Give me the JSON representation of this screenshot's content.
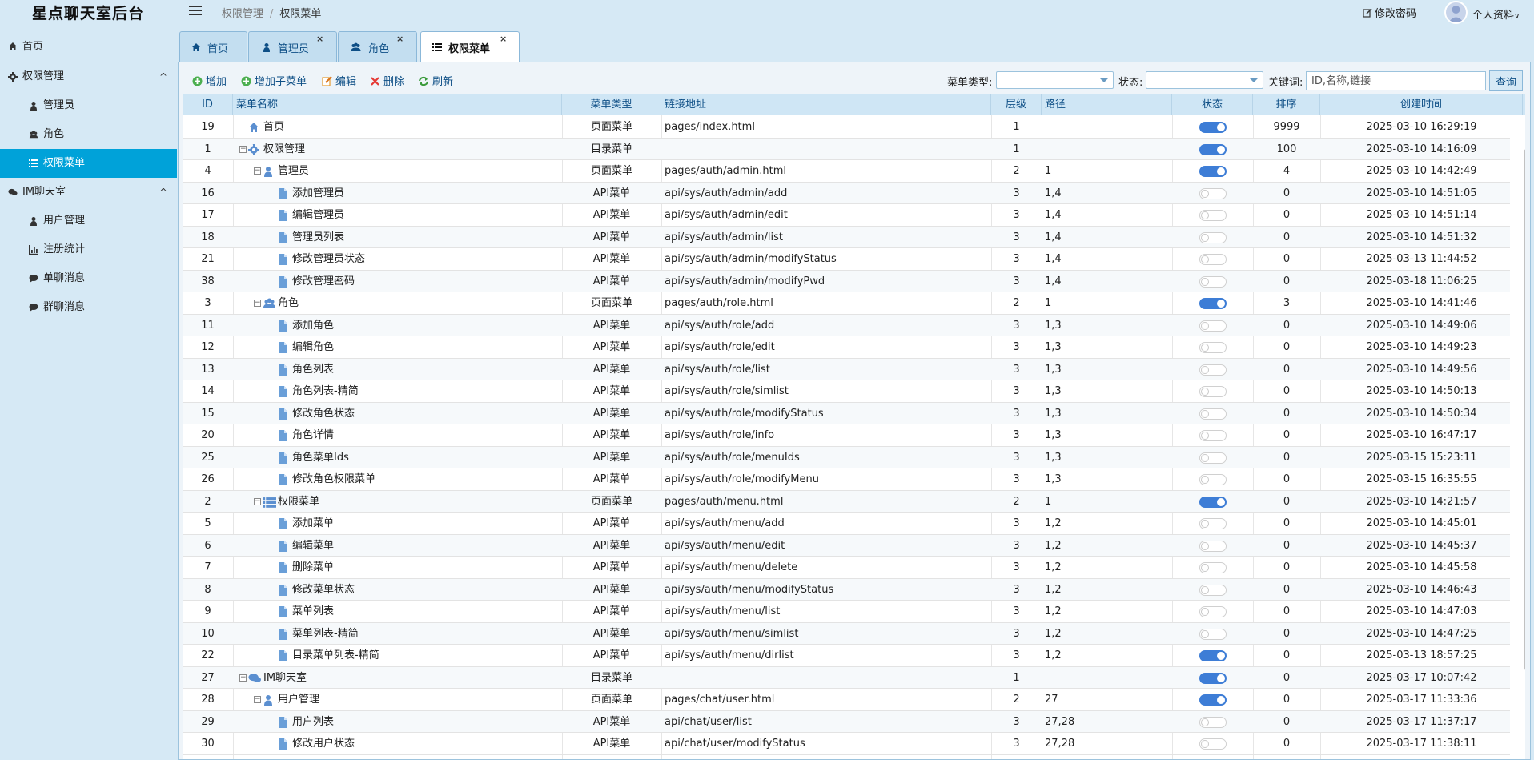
{
  "app": {
    "title": "星点聊天室后台"
  },
  "breadcrumb": {
    "parent": "权限管理",
    "sep": "/",
    "current": "权限菜单"
  },
  "header": {
    "change_pwd": "修改密码",
    "profile": "个人资料"
  },
  "sidebar": {
    "items": [
      {
        "label": "首页",
        "icon": "home-icon"
      },
      {
        "label": "权限管理",
        "icon": "gear-icon"
      },
      {
        "label": "管理员",
        "icon": "user-icon"
      },
      {
        "label": "角色",
        "icon": "users-icon"
      },
      {
        "label": "权限菜单",
        "icon": "list-icon"
      },
      {
        "label": "IM聊天室",
        "icon": "chat-icon"
      },
      {
        "label": "用户管理",
        "icon": "user-icon"
      },
      {
        "label": "注册统计",
        "icon": "bar-chart-icon"
      },
      {
        "label": "单聊消息",
        "icon": "comment-icon"
      },
      {
        "label": "群聊消息",
        "icon": "comment-icon"
      }
    ]
  },
  "tabs": [
    {
      "label": "首页",
      "icon": "home-icon"
    },
    {
      "label": "管理员",
      "icon": "user-icon",
      "close": "×"
    },
    {
      "label": "角色",
      "icon": "users-icon",
      "close": "×"
    },
    {
      "label": "权限菜单",
      "icon": "list-icon",
      "close": "×"
    }
  ],
  "toolbar": {
    "add": "增加",
    "add_child": "增加子菜单",
    "edit": "编辑",
    "delete": "删除",
    "refresh": "刷新",
    "menu_type_label": "菜单类型:",
    "status_label": "状态:",
    "keyword_label": "关键词:",
    "keyword_placeholder": "ID,名称,链接",
    "query": "查询"
  },
  "table": {
    "columns": {
      "id": "ID",
      "name": "菜单名称",
      "type": "菜单类型",
      "url": "链接地址",
      "level": "层级",
      "path": "路径",
      "status": "状态",
      "sort": "排序",
      "created": "创建时间"
    },
    "rows": [
      {
        "id": "19",
        "name": "首页",
        "type": "页面菜单",
        "url": "pages/index.html",
        "level": "1",
        "path": "",
        "status": true,
        "sort": "9999",
        "created": "2025-03-10 16:29:19"
      },
      {
        "id": "1",
        "name": "权限管理",
        "type": "目录菜单",
        "url": "",
        "level": "1",
        "path": "",
        "status": true,
        "sort": "100",
        "created": "2025-03-10 14:16:09"
      },
      {
        "id": "4",
        "name": "管理员",
        "type": "页面菜单",
        "url": "pages/auth/admin.html",
        "level": "2",
        "path": "1",
        "status": true,
        "sort": "4",
        "created": "2025-03-10 14:42:49"
      },
      {
        "id": "16",
        "name": "添加管理员",
        "type": "API菜单",
        "url": "api/sys/auth/admin/add",
        "level": "3",
        "path": "1,4",
        "status": false,
        "sort": "0",
        "created": "2025-03-10 14:51:05"
      },
      {
        "id": "17",
        "name": "编辑管理员",
        "type": "API菜单",
        "url": "api/sys/auth/admin/edit",
        "level": "3",
        "path": "1,4",
        "status": false,
        "sort": "0",
        "created": "2025-03-10 14:51:14"
      },
      {
        "id": "18",
        "name": "管理员列表",
        "type": "API菜单",
        "url": "api/sys/auth/admin/list",
        "level": "3",
        "path": "1,4",
        "status": false,
        "sort": "0",
        "created": "2025-03-10 14:51:32"
      },
      {
        "id": "21",
        "name": "修改管理员状态",
        "type": "API菜单",
        "url": "api/sys/auth/admin/modifyStatus",
        "level": "3",
        "path": "1,4",
        "status": false,
        "sort": "0",
        "created": "2025-03-13 11:44:52"
      },
      {
        "id": "38",
        "name": "修改管理密码",
        "type": "API菜单",
        "url": "api/sys/auth/admin/modifyPwd",
        "level": "3",
        "path": "1,4",
        "status": false,
        "sort": "0",
        "created": "2025-03-18 11:06:25"
      },
      {
        "id": "3",
        "name": "角色",
        "type": "页面菜单",
        "url": "pages/auth/role.html",
        "level": "2",
        "path": "1",
        "status": true,
        "sort": "3",
        "created": "2025-03-10 14:41:46"
      },
      {
        "id": "11",
        "name": "添加角色",
        "type": "API菜单",
        "url": "api/sys/auth/role/add",
        "level": "3",
        "path": "1,3",
        "status": false,
        "sort": "0",
        "created": "2025-03-10 14:49:06"
      },
      {
        "id": "12",
        "name": "编辑角色",
        "type": "API菜单",
        "url": "api/sys/auth/role/edit",
        "level": "3",
        "path": "1,3",
        "status": false,
        "sort": "0",
        "created": "2025-03-10 14:49:23"
      },
      {
        "id": "13",
        "name": "角色列表",
        "type": "API菜单",
        "url": "api/sys/auth/role/list",
        "level": "3",
        "path": "1,3",
        "status": false,
        "sort": "0",
        "created": "2025-03-10 14:49:56"
      },
      {
        "id": "14",
        "name": "角色列表-精简",
        "type": "API菜单",
        "url": "api/sys/auth/role/simlist",
        "level": "3",
        "path": "1,3",
        "status": false,
        "sort": "0",
        "created": "2025-03-10 14:50:13"
      },
      {
        "id": "15",
        "name": "修改角色状态",
        "type": "API菜单",
        "url": "api/sys/auth/role/modifyStatus",
        "level": "3",
        "path": "1,3",
        "status": false,
        "sort": "0",
        "created": "2025-03-10 14:50:34"
      },
      {
        "id": "20",
        "name": "角色详情",
        "type": "API菜单",
        "url": "api/sys/auth/role/info",
        "level": "3",
        "path": "1,3",
        "status": false,
        "sort": "0",
        "created": "2025-03-10 16:47:17"
      },
      {
        "id": "25",
        "name": "角色菜单Ids",
        "type": "API菜单",
        "url": "api/sys/auth/role/menuIds",
        "level": "3",
        "path": "1,3",
        "status": false,
        "sort": "0",
        "created": "2025-03-15 15:23:11"
      },
      {
        "id": "26",
        "name": "修改角色权限菜单",
        "type": "API菜单",
        "url": "api/sys/auth/role/modifyMenu",
        "level": "3",
        "path": "1,3",
        "status": false,
        "sort": "0",
        "created": "2025-03-15 16:35:55"
      },
      {
        "id": "2",
        "name": "权限菜单",
        "type": "页面菜单",
        "url": "pages/auth/menu.html",
        "level": "2",
        "path": "1",
        "status": true,
        "sort": "0",
        "created": "2025-03-10 14:21:57"
      },
      {
        "id": "5",
        "name": "添加菜单",
        "type": "API菜单",
        "url": "api/sys/auth/menu/add",
        "level": "3",
        "path": "1,2",
        "status": false,
        "sort": "0",
        "created": "2025-03-10 14:45:01"
      },
      {
        "id": "6",
        "name": "编辑菜单",
        "type": "API菜单",
        "url": "api/sys/auth/menu/edit",
        "level": "3",
        "path": "1,2",
        "status": false,
        "sort": "0",
        "created": "2025-03-10 14:45:37"
      },
      {
        "id": "7",
        "name": "删除菜单",
        "type": "API菜单",
        "url": "api/sys/auth/menu/delete",
        "level": "3",
        "path": "1,2",
        "status": false,
        "sort": "0",
        "created": "2025-03-10 14:45:58"
      },
      {
        "id": "8",
        "name": "修改菜单状态",
        "type": "API菜单",
        "url": "api/sys/auth/menu/modifyStatus",
        "level": "3",
        "path": "1,2",
        "status": false,
        "sort": "0",
        "created": "2025-03-10 14:46:43"
      },
      {
        "id": "9",
        "name": "菜单列表",
        "type": "API菜单",
        "url": "api/sys/auth/menu/list",
        "level": "3",
        "path": "1,2",
        "status": false,
        "sort": "0",
        "created": "2025-03-10 14:47:03"
      },
      {
        "id": "10",
        "name": "菜单列表-精简",
        "type": "API菜单",
        "url": "api/sys/auth/menu/simlist",
        "level": "3",
        "path": "1,2",
        "status": false,
        "sort": "0",
        "created": "2025-03-10 14:47:25"
      },
      {
        "id": "22",
        "name": "目录菜单列表-精简",
        "type": "API菜单",
        "url": "api/sys/auth/menu/dirlist",
        "level": "3",
        "path": "1,2",
        "status": true,
        "sort": "0",
        "created": "2025-03-13 18:57:25"
      },
      {
        "id": "27",
        "name": "IM聊天室",
        "type": "目录菜单",
        "url": "",
        "level": "1",
        "path": "",
        "status": true,
        "sort": "0",
        "created": "2025-03-17 10:07:42"
      },
      {
        "id": "28",
        "name": "用户管理",
        "type": "页面菜单",
        "url": "pages/chat/user.html",
        "level": "2",
        "path": "27",
        "status": true,
        "sort": "0",
        "created": "2025-03-17 11:33:36"
      },
      {
        "id": "29",
        "name": "用户列表",
        "type": "API菜单",
        "url": "api/chat/user/list",
        "level": "3",
        "path": "27,28",
        "status": false,
        "sort": "0",
        "created": "2025-03-17 11:37:17"
      },
      {
        "id": "30",
        "name": "修改用户状态",
        "type": "API菜单",
        "url": "api/chat/user/modifyStatus",
        "level": "3",
        "path": "27,28",
        "status": false,
        "sort": "0",
        "created": "2025-03-17 11:38:11"
      }
    ]
  },
  "colors": {
    "accent": "#00a2d9",
    "toggle_on": "#3d7dd6",
    "link": "#0e4f86",
    "bg": "#d6e9f5"
  }
}
